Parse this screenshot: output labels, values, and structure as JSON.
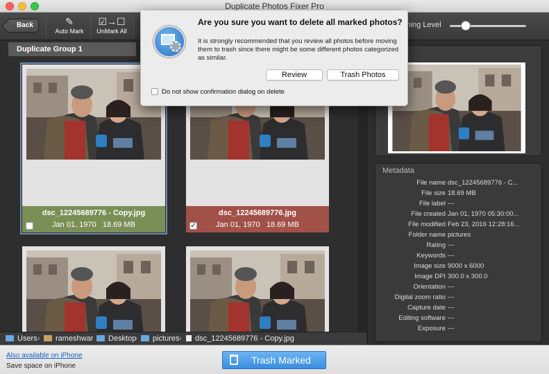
{
  "window": {
    "title": "Duplicate Photos Fixer Pro"
  },
  "toolbar": {
    "back_label": "Back",
    "auto_mark_label": "Auto Mark",
    "unmark_all_label": "UnMark All",
    "matching_level_label": "ching Level",
    "matching_level_value": 0.15
  },
  "group": {
    "title": "Duplicate Group 1"
  },
  "cards": [
    {
      "name": "dsc_12245689776 - Copy.jpg",
      "date": "Jan 01, 1970",
      "size": "18.69 MB",
      "checked": false,
      "status": "keep"
    },
    {
      "name": "dsc_12245689776.jpg",
      "date": "Jan 01, 1970",
      "size": "18.69 MB",
      "checked": true,
      "checkmark": "✓",
      "status": "marked"
    }
  ],
  "metadata": {
    "title": "Metadata",
    "rows": [
      {
        "key": "File name",
        "value": "dsc_12245689776 - C..."
      },
      {
        "key": "File size",
        "value": "18.69 MB"
      },
      {
        "key": "File label",
        "value": "---"
      },
      {
        "key": "File created",
        "value": "Jan 01, 1970 05:30:00..."
      },
      {
        "key": "File modified",
        "value": "Feb 23, 2016 12:28:16..."
      },
      {
        "key": "Folder name",
        "value": "pictures"
      },
      {
        "key": "Rating",
        "value": "---"
      },
      {
        "key": "Keywords",
        "value": "---"
      },
      {
        "key": "Image size",
        "value": "9000 x 6000"
      },
      {
        "key": "Image DPI",
        "value": "300.0 x 300.0"
      },
      {
        "key": "Orientation",
        "value": "---"
      },
      {
        "key": "Digital zoom ratio",
        "value": "---"
      },
      {
        "key": "Capture date",
        "value": "---"
      },
      {
        "key": "Editing software",
        "value": "---"
      },
      {
        "key": "Exposure",
        "value": "---"
      }
    ]
  },
  "breadcrumb": {
    "items": [
      "Users",
      "rameshwar",
      "Desktop",
      "pictures",
      "dsc_12245689776 - Copy.jpg"
    ],
    "separator": "›"
  },
  "bottom": {
    "iphone_link": "Also available on iPhone",
    "save_text": "Save space on iPhone",
    "trash_button": "Trash Marked"
  },
  "dialog": {
    "title": "Are you sure you want to delete all marked photos?",
    "body": "It is strongly recommended that you review all photos before moving them to trash since there might be some different photos categorized as similar.",
    "review_button": "Review",
    "trash_button": "Trash Photos",
    "checkbox_label": "Do not show confirmation dialog on delete",
    "checkbox_checked": false
  },
  "colors": {
    "keep_caption": "#7a8f56",
    "marked_caption": "#a25148",
    "accent": "#3a8de0"
  }
}
